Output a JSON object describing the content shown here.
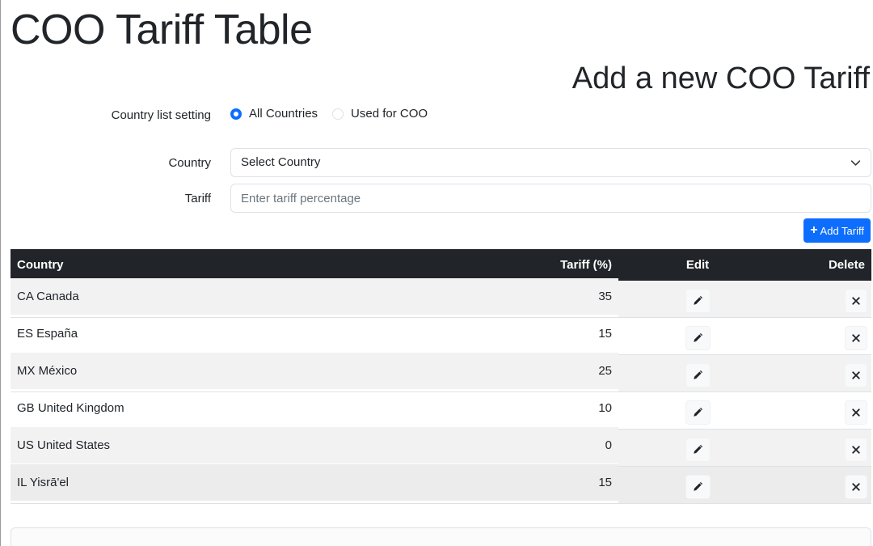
{
  "page": {
    "title": "COO Tariff Table"
  },
  "form": {
    "title": "Add a new COO Tariff",
    "country_list_setting_label": "Country list setting",
    "radio_options": [
      {
        "label": "All Countries",
        "checked": true
      },
      {
        "label": "Used for COO",
        "checked": false
      }
    ],
    "country_label": "Country",
    "country_select_value": "Select Country",
    "tariff_label": "Tariff",
    "tariff_placeholder": "Enter tariff percentage",
    "add_button_label": "Add Tariff"
  },
  "table": {
    "headers": {
      "country": "Country",
      "tariff": "Tariff (%)",
      "edit": "Edit",
      "delete": "Delete"
    },
    "rows": [
      {
        "country": "CA Canada",
        "tariff": "35"
      },
      {
        "country": "ES España",
        "tariff": "15"
      },
      {
        "country": "MX México",
        "tariff": "25"
      },
      {
        "country": "GB United Kingdom",
        "tariff": "10"
      },
      {
        "country": "US United States",
        "tariff": "0"
      },
      {
        "country": "IL Yisrā'el",
        "tariff": "15"
      }
    ]
  },
  "colors": {
    "primary": "#0d6efd",
    "table_header_bg": "#212529",
    "stripe": "#f2f2f2"
  },
  "icons": {
    "edit": "pencil-icon",
    "delete": "close-icon",
    "add": "plus-icon",
    "select": "chevron-down-icon"
  }
}
